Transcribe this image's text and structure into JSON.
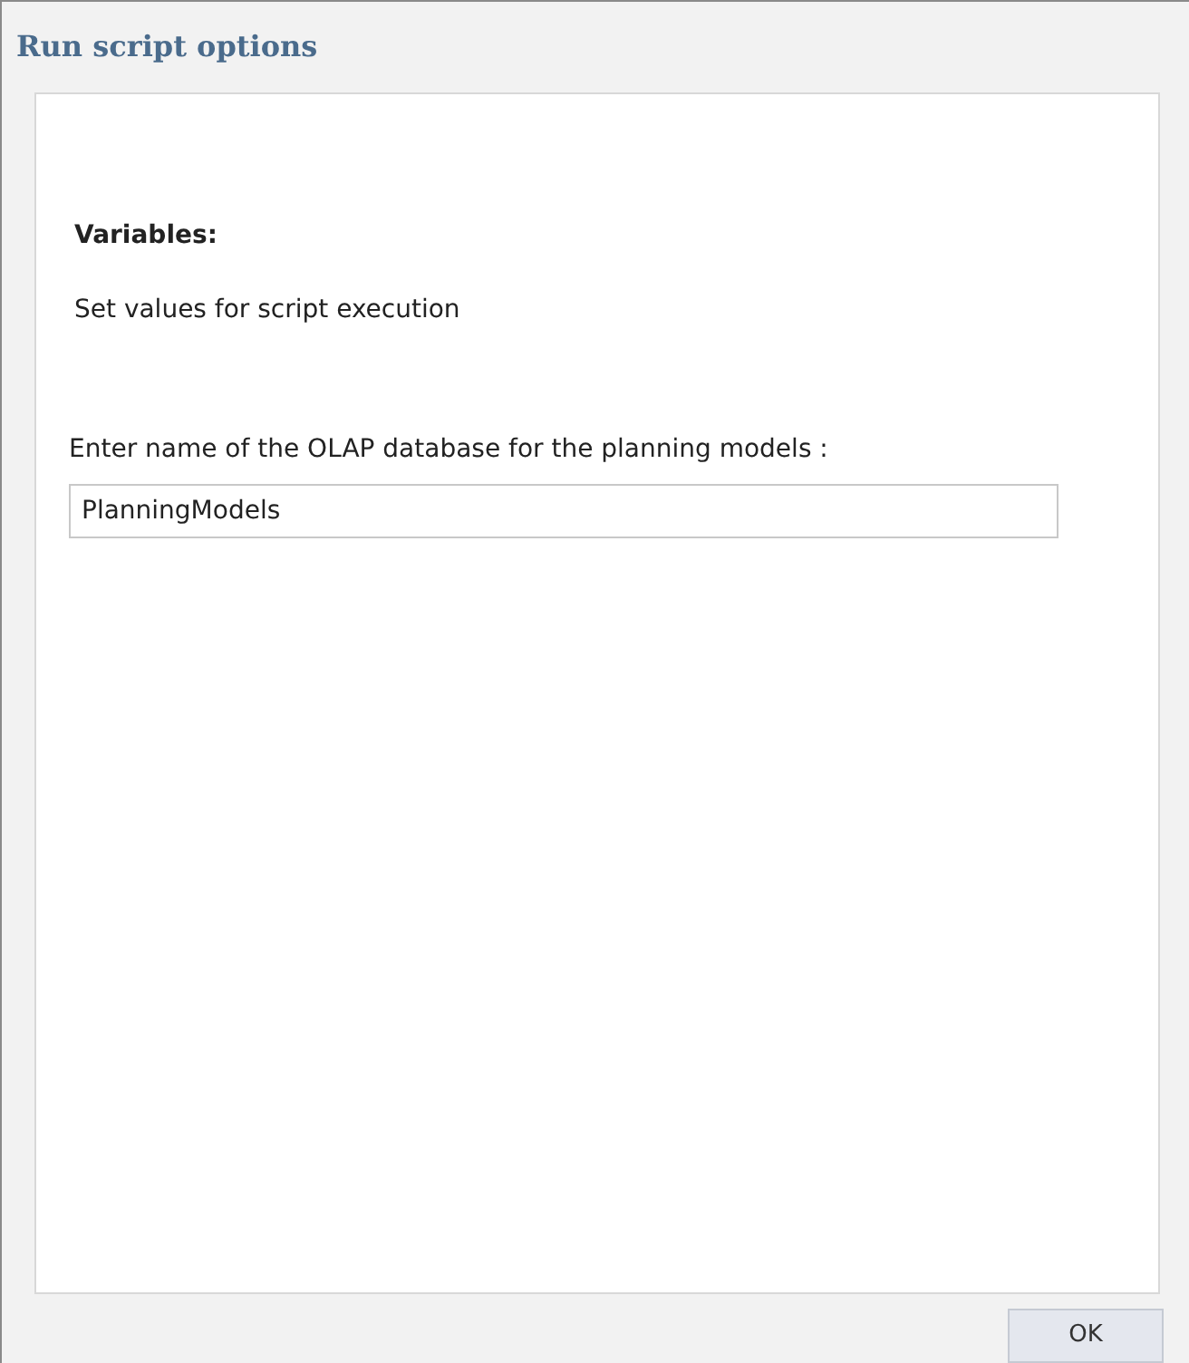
{
  "window": {
    "title": "Run script options"
  },
  "section": {
    "heading": "Variables:",
    "description": "Set values for script execution"
  },
  "field": {
    "label": "Enter name of the OLAP database for the planning models :",
    "value": "PlanningModels"
  },
  "buttons": [
    "OK"
  ]
}
